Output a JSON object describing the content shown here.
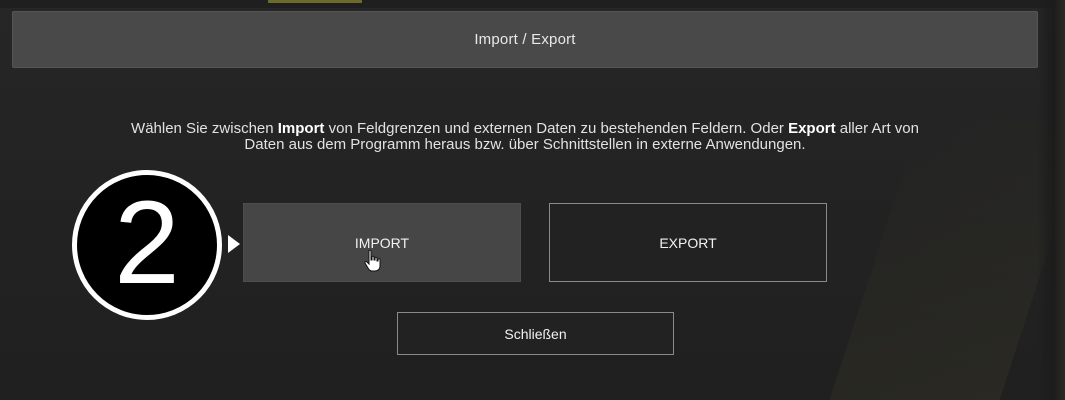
{
  "dialog": {
    "title": "Import / Export"
  },
  "description": {
    "part1": "Wählen Sie zwischen ",
    "bold1": "Import",
    "part2": " von Feldgrenzen und externen Daten zu bestehenden Feldern. Oder ",
    "bold2": "Export",
    "part3": " aller Art von Daten aus dem Programm heraus bzw. über Schnittstellen in externe Anwendungen."
  },
  "buttons": {
    "import_label": "IMPORT",
    "export_label": "EXPORT",
    "close_label": "Schließen"
  },
  "annotation": {
    "step_number": "2"
  },
  "icons": {
    "cursor": "hand-pointer-icon",
    "arrow": "triangle-right-icon"
  },
  "colors": {
    "background": "#232323",
    "header": "#494949",
    "import_button": "#464646",
    "export_border": "#8a8a8a",
    "text": "#f2f2f2"
  }
}
